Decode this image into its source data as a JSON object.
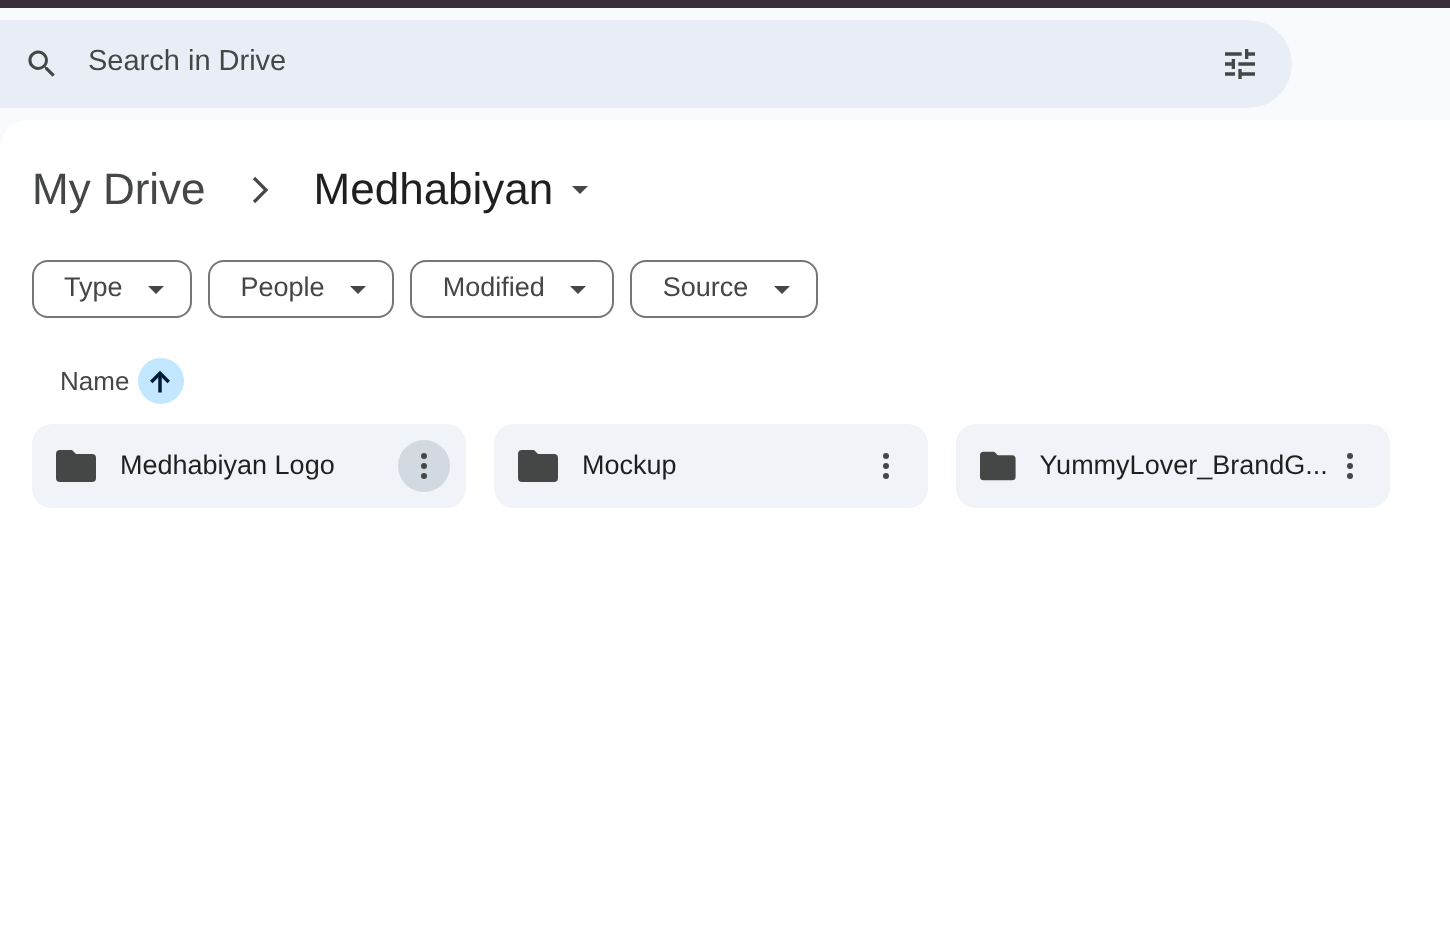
{
  "search": {
    "placeholder": "Search in Drive"
  },
  "breadcrumb": [
    {
      "label": "My Drive",
      "current": false
    },
    {
      "label": "Medhabiyan",
      "current": true
    }
  ],
  "filters": [
    {
      "label": "Type"
    },
    {
      "label": "People"
    },
    {
      "label": "Modified"
    },
    {
      "label": "Source"
    }
  ],
  "sort": {
    "label": "Name",
    "ascending": true
  },
  "folders": [
    {
      "name": "Medhabiyan Logo",
      "menu_highlighted": true
    },
    {
      "name": "Mockup",
      "menu_highlighted": false
    },
    {
      "name": "YummyLover_BrandG...",
      "menu_highlighted": false
    }
  ]
}
